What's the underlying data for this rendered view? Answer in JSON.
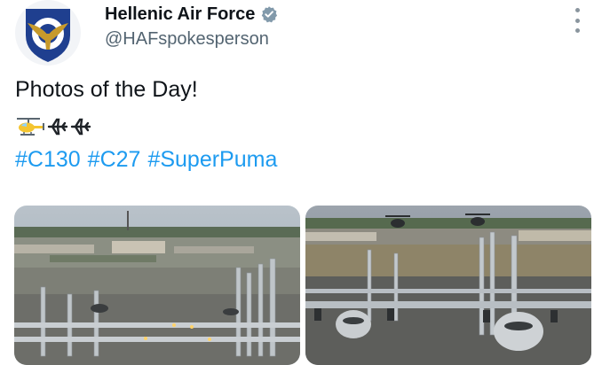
{
  "author": {
    "name": "Hellenic Air Force",
    "handle": "@HAFspokesperson",
    "verified_icon": "verified-badge-icon",
    "avatar_icon": "eagle-roundel-icon"
  },
  "tweet": {
    "text": "Photos of the Day!",
    "emojis": [
      "helicopter-icon",
      "airplane-icon",
      "airplane-icon"
    ],
    "hashtags": [
      "#C130",
      "#C27",
      "#SuperPuma"
    ]
  },
  "menu": {
    "icon": "more-vertical-icon"
  },
  "media": [
    {
      "name": "photo-1",
      "subject": "C-130 elephant walk on runway"
    },
    {
      "name": "photo-2",
      "subject": "C-130 formation with helicopters above"
    }
  ],
  "colors": {
    "link": "#1d9bf0",
    "secondary_text": "#536471",
    "verified": "#829aab"
  }
}
